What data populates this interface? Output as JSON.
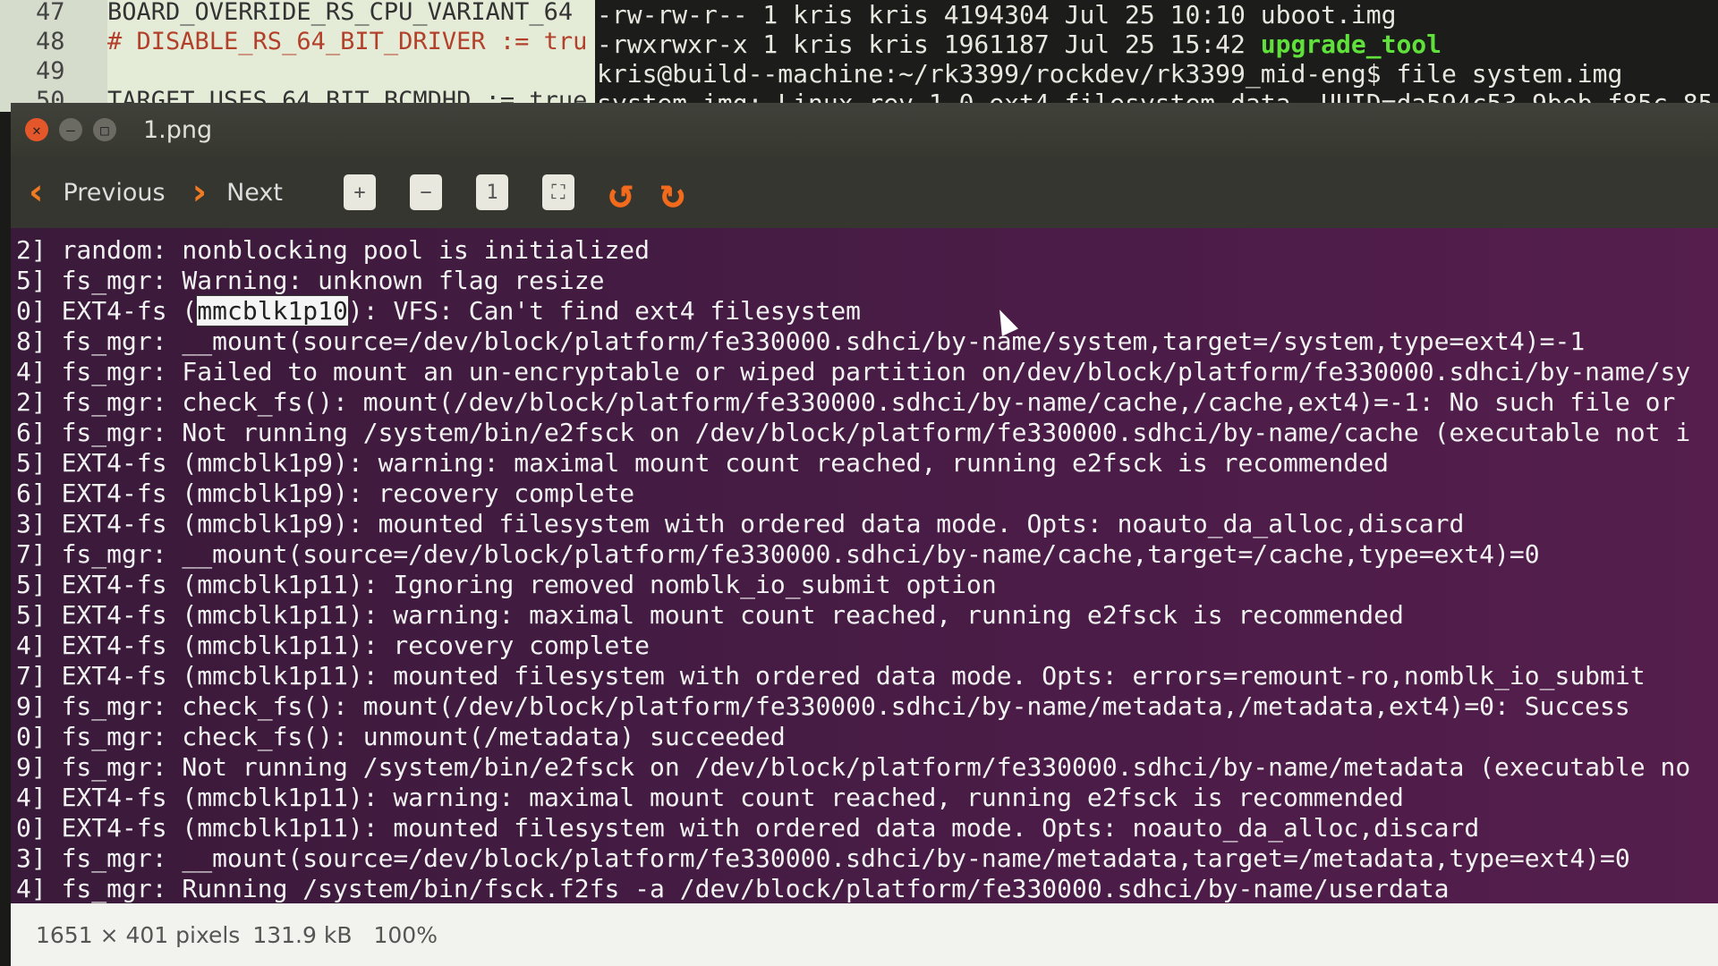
{
  "editor": {
    "lines": [
      {
        "num": "47",
        "text": "BOARD_OVERRIDE_RS_CPU_VARIANT_64",
        "red": false
      },
      {
        "num": "48",
        "text": "# DISABLE_RS_64_BIT_DRIVER := tru",
        "red": true
      },
      {
        "num": "49",
        "text": "",
        "red": false
      },
      {
        "num": "50",
        "text": "TARGET_USES_64_BIT_BCMDHD := true",
        "red": false
      }
    ]
  },
  "terminal": {
    "lines": [
      "-rw-rw-r-- 1 kris kris    4194304 Jul 25 10:10 uboot.img",
      "-rwxrwxr-x 1 kris kris    1961187 Jul 25 15:42 ",
      "kris@build--machine:~/rk3399/rockdev/rk3399_mid-eng$ file system.img",
      "system.img: Linux rev 1.0 ext4 filesystem data, UUID=da594c53-9beb-f85c-85"
    ],
    "green_file": "upgrade_tool"
  },
  "viewer": {
    "title": "1.png",
    "previous_label": "Previous",
    "next_label": "Next",
    "accent": "#f07a22",
    "tools": [
      "zoom-in-icon",
      "zoom-out-icon",
      "original-size-icon",
      "fit-icon",
      "rotate-left-icon",
      "rotate-right-icon"
    ],
    "log_before_highlight": "0] EXT4-fs (",
    "highlight": "mmcblk1p10",
    "log_after_highlight": "): VFS: Can't find ext4 filesystem",
    "log": [
      "2] random: nonblocking pool is initialized",
      "5] fs_mgr: Warning: unknown flag resize",
      null,
      "8] fs_mgr: __mount(source=/dev/block/platform/fe330000.sdhci/by-name/system,target=/system,type=ext4)=-1",
      "4] fs_mgr: Failed to mount an un-encryptable or wiped partition on/dev/block/platform/fe330000.sdhci/by-name/sy",
      "2] fs_mgr: check_fs(): mount(/dev/block/platform/fe330000.sdhci/by-name/cache,/cache,ext4)=-1: No such file or",
      "6] fs_mgr: Not running /system/bin/e2fsck on /dev/block/platform/fe330000.sdhci/by-name/cache (executable not i",
      "5] EXT4-fs (mmcblk1p9): warning: maximal mount count reached, running e2fsck is recommended",
      "6] EXT4-fs (mmcblk1p9): recovery complete",
      "3] EXT4-fs (mmcblk1p9): mounted filesystem with ordered data mode. Opts: noauto_da_alloc,discard",
      "7] fs_mgr: __mount(source=/dev/block/platform/fe330000.sdhci/by-name/cache,target=/cache,type=ext4)=0",
      "5] EXT4-fs (mmcblk1p11): Ignoring removed nomblk_io_submit option",
      "5] EXT4-fs (mmcblk1p11): warning: maximal mount count reached, running e2fsck is recommended",
      "4] EXT4-fs (mmcblk1p11): recovery complete",
      "7] EXT4-fs (mmcblk1p11): mounted filesystem with ordered data mode. Opts: errors=remount-ro,nomblk_io_submit",
      "9] fs_mgr: check_fs(): mount(/dev/block/platform/fe330000.sdhci/by-name/metadata,/metadata,ext4)=0: Success",
      "0] fs_mgr: check_fs(): unmount(/metadata) succeeded",
      "9] fs_mgr: Not running /system/bin/e2fsck on /dev/block/platform/fe330000.sdhci/by-name/metadata (executable no",
      "4] EXT4-fs (mmcblk1p11): warning: maximal mount count reached, running e2fsck is recommended",
      "0] EXT4-fs (mmcblk1p11): mounted filesystem with ordered data mode. Opts: noauto_da_alloc,discard",
      "3] fs_mgr: __mount(source=/dev/block/platform/fe330000.sdhci/by-name/metadata,target=/metadata,type=ext4)=0",
      "4] fs_mgr: Running /system/bin/fsck.f2fs -a /dev/block/platform/fe330000.sdhci/by-name/userdata"
    ],
    "status": {
      "dimensions": "1651 × 401 pixels",
      "size": "131.9 kB",
      "zoom": "100%"
    }
  }
}
